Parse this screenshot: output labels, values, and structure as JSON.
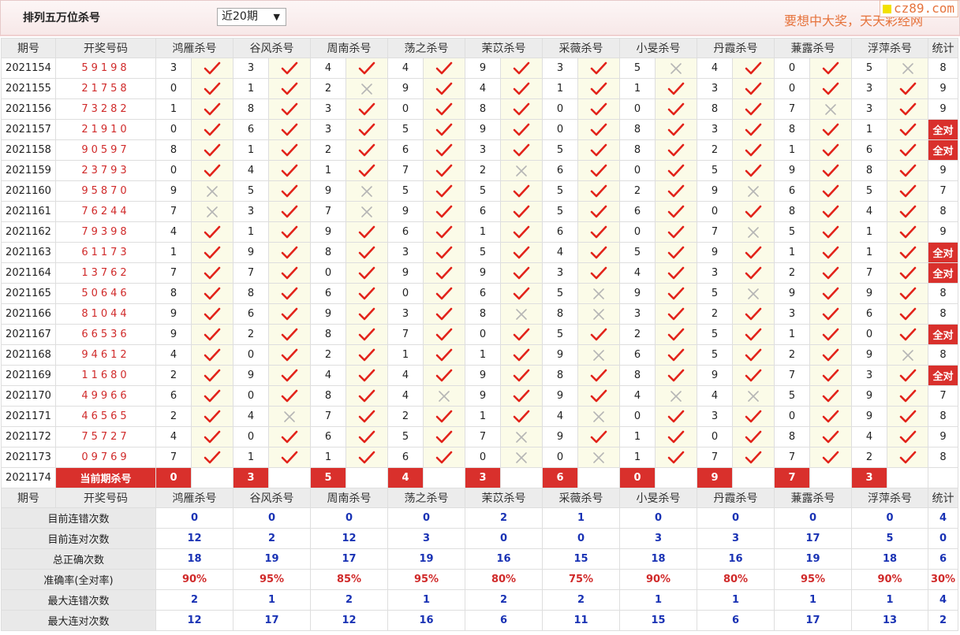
{
  "header": {
    "title": "排列五万位杀号",
    "period_select": "近20期",
    "slogan": "要想中大奖，天天彩经网",
    "logo": "cz89.com"
  },
  "columns": {
    "period": "期号",
    "draw": "开奖号码",
    "experts": [
      "鸿雁杀号",
      "谷风杀号",
      "周南杀号",
      "荡之杀号",
      "茉苡杀号",
      "采薇杀号",
      "小旻杀号",
      "丹霞杀号",
      "蒹露杀号",
      "浮萍杀号"
    ],
    "total": "统计"
  },
  "rows": [
    {
      "period": "2021154",
      "draw": "59198",
      "kills": [
        3,
        3,
        4,
        4,
        9,
        3,
        5,
        4,
        0,
        5
      ],
      "ok": [
        1,
        1,
        1,
        1,
        1,
        1,
        0,
        1,
        1,
        0
      ],
      "total": "8"
    },
    {
      "period": "2021155",
      "draw": "21758",
      "kills": [
        0,
        1,
        2,
        9,
        4,
        1,
        1,
        3,
        0,
        3
      ],
      "ok": [
        1,
        1,
        0,
        1,
        1,
        1,
        1,
        1,
        1,
        1
      ],
      "total": "9"
    },
    {
      "period": "2021156",
      "draw": "73282",
      "kills": [
        1,
        8,
        3,
        0,
        8,
        0,
        0,
        8,
        7,
        3
      ],
      "ok": [
        1,
        1,
        1,
        1,
        1,
        1,
        1,
        1,
        0,
        1
      ],
      "total": "9"
    },
    {
      "period": "2021157",
      "draw": "21910",
      "kills": [
        0,
        6,
        3,
        5,
        9,
        0,
        8,
        3,
        8,
        1
      ],
      "ok": [
        1,
        1,
        1,
        1,
        1,
        1,
        1,
        1,
        1,
        1
      ],
      "total": "全对"
    },
    {
      "period": "2021158",
      "draw": "90597",
      "kills": [
        8,
        1,
        2,
        6,
        3,
        5,
        8,
        2,
        1,
        6
      ],
      "ok": [
        1,
        1,
        1,
        1,
        1,
        1,
        1,
        1,
        1,
        1
      ],
      "total": "全对"
    },
    {
      "period": "2021159",
      "draw": "23793",
      "kills": [
        0,
        4,
        1,
        7,
        2,
        6,
        0,
        5,
        9,
        8
      ],
      "ok": [
        1,
        1,
        1,
        1,
        0,
        1,
        1,
        1,
        1,
        1
      ],
      "total": "9"
    },
    {
      "period": "2021160",
      "draw": "95870",
      "kills": [
        9,
        5,
        9,
        5,
        5,
        5,
        2,
        9,
        6,
        5
      ],
      "ok": [
        0,
        1,
        0,
        1,
        1,
        1,
        1,
        0,
        1,
        1
      ],
      "total": "7"
    },
    {
      "period": "2021161",
      "draw": "76244",
      "kills": [
        7,
        3,
        7,
        9,
        6,
        5,
        6,
        0,
        8,
        4
      ],
      "ok": [
        0,
        1,
        0,
        1,
        1,
        1,
        1,
        1,
        1,
        1
      ],
      "total": "8"
    },
    {
      "period": "2021162",
      "draw": "79398",
      "kills": [
        4,
        1,
        9,
        6,
        1,
        6,
        0,
        7,
        5,
        1
      ],
      "ok": [
        1,
        1,
        1,
        1,
        1,
        1,
        1,
        0,
        1,
        1
      ],
      "total": "9"
    },
    {
      "period": "2021163",
      "draw": "61173",
      "kills": [
        1,
        9,
        8,
        3,
        5,
        4,
        5,
        9,
        1,
        1
      ],
      "ok": [
        1,
        1,
        1,
        1,
        1,
        1,
        1,
        1,
        1,
        1
      ],
      "total": "全对"
    },
    {
      "period": "2021164",
      "draw": "13762",
      "kills": [
        7,
        7,
        0,
        9,
        9,
        3,
        4,
        3,
        2,
        7
      ],
      "ok": [
        1,
        1,
        1,
        1,
        1,
        1,
        1,
        1,
        1,
        1
      ],
      "total": "全对"
    },
    {
      "period": "2021165",
      "draw": "50646",
      "kills": [
        8,
        8,
        6,
        0,
        6,
        5,
        9,
        5,
        9,
        9
      ],
      "ok": [
        1,
        1,
        1,
        1,
        1,
        0,
        1,
        0,
        1,
        1
      ],
      "total": "8"
    },
    {
      "period": "2021166",
      "draw": "81044",
      "kills": [
        9,
        6,
        9,
        3,
        8,
        8,
        3,
        2,
        3,
        6
      ],
      "ok": [
        1,
        1,
        1,
        1,
        0,
        0,
        1,
        1,
        1,
        1
      ],
      "total": "8"
    },
    {
      "period": "2021167",
      "draw": "66536",
      "kills": [
        9,
        2,
        8,
        7,
        0,
        5,
        2,
        5,
        1,
        0
      ],
      "ok": [
        1,
        1,
        1,
        1,
        1,
        1,
        1,
        1,
        1,
        1
      ],
      "total": "全对"
    },
    {
      "period": "2021168",
      "draw": "94612",
      "kills": [
        4,
        0,
        2,
        1,
        1,
        9,
        6,
        5,
        2,
        9
      ],
      "ok": [
        1,
        1,
        1,
        1,
        1,
        0,
        1,
        1,
        1,
        0
      ],
      "total": "8"
    },
    {
      "period": "2021169",
      "draw": "11680",
      "kills": [
        2,
        9,
        4,
        4,
        9,
        8,
        8,
        9,
        7,
        3
      ],
      "ok": [
        1,
        1,
        1,
        1,
        1,
        1,
        1,
        1,
        1,
        1
      ],
      "total": "全对"
    },
    {
      "period": "2021170",
      "draw": "49966",
      "kills": [
        6,
        0,
        8,
        4,
        9,
        9,
        4,
        4,
        5,
        9
      ],
      "ok": [
        1,
        1,
        1,
        0,
        1,
        1,
        0,
        0,
        1,
        1
      ],
      "total": "7"
    },
    {
      "period": "2021171",
      "draw": "46565",
      "kills": [
        2,
        4,
        7,
        2,
        1,
        4,
        0,
        3,
        0,
        9
      ],
      "ok": [
        1,
        0,
        1,
        1,
        1,
        0,
        1,
        1,
        1,
        1
      ],
      "total": "8"
    },
    {
      "period": "2021172",
      "draw": "75727",
      "kills": [
        4,
        0,
        6,
        5,
        7,
        9,
        1,
        0,
        8,
        4
      ],
      "ok": [
        1,
        1,
        1,
        1,
        0,
        1,
        1,
        1,
        1,
        1
      ],
      "total": "9"
    },
    {
      "period": "2021173",
      "draw": "09769",
      "kills": [
        7,
        1,
        1,
        6,
        0,
        0,
        1,
        7,
        7,
        2
      ],
      "ok": [
        1,
        1,
        1,
        1,
        0,
        0,
        1,
        1,
        1,
        1
      ],
      "total": "8"
    }
  ],
  "current": {
    "period": "2021174",
    "label": "当前期杀号",
    "kills": [
      "0",
      "3",
      "5",
      "4",
      "3",
      "6",
      "0",
      "9",
      "7",
      "3"
    ]
  },
  "stats": [
    {
      "label": "目前连错次数",
      "values": [
        "0",
        "0",
        "0",
        "0",
        "2",
        "1",
        "0",
        "0",
        "0",
        "0"
      ],
      "total": "4",
      "pct": false
    },
    {
      "label": "目前连对次数",
      "values": [
        "12",
        "2",
        "12",
        "3",
        "0",
        "0",
        "3",
        "3",
        "17",
        "5"
      ],
      "total": "0",
      "pct": false
    },
    {
      "label": "总正确次数",
      "values": [
        "18",
        "19",
        "17",
        "19",
        "16",
        "15",
        "18",
        "16",
        "19",
        "18"
      ],
      "total": "6",
      "pct": false
    },
    {
      "label": "准确率(全对率)",
      "values": [
        "90%",
        "95%",
        "85%",
        "95%",
        "80%",
        "75%",
        "90%",
        "80%",
        "95%",
        "90%"
      ],
      "total": "30%",
      "pct": true
    },
    {
      "label": "最大连错次数",
      "values": [
        "2",
        "1",
        "2",
        "1",
        "2",
        "2",
        "1",
        "1",
        "1",
        "1"
      ],
      "total": "4",
      "pct": false
    },
    {
      "label": "最大连对次数",
      "values": [
        "12",
        "17",
        "12",
        "16",
        "6",
        "11",
        "15",
        "6",
        "17",
        "13"
      ],
      "total": "2",
      "pct": false
    }
  ],
  "colors": {
    "accent_red": "#d9302c",
    "stat_blue": "#1932b4",
    "mark_bg": "#fbfbe8"
  }
}
